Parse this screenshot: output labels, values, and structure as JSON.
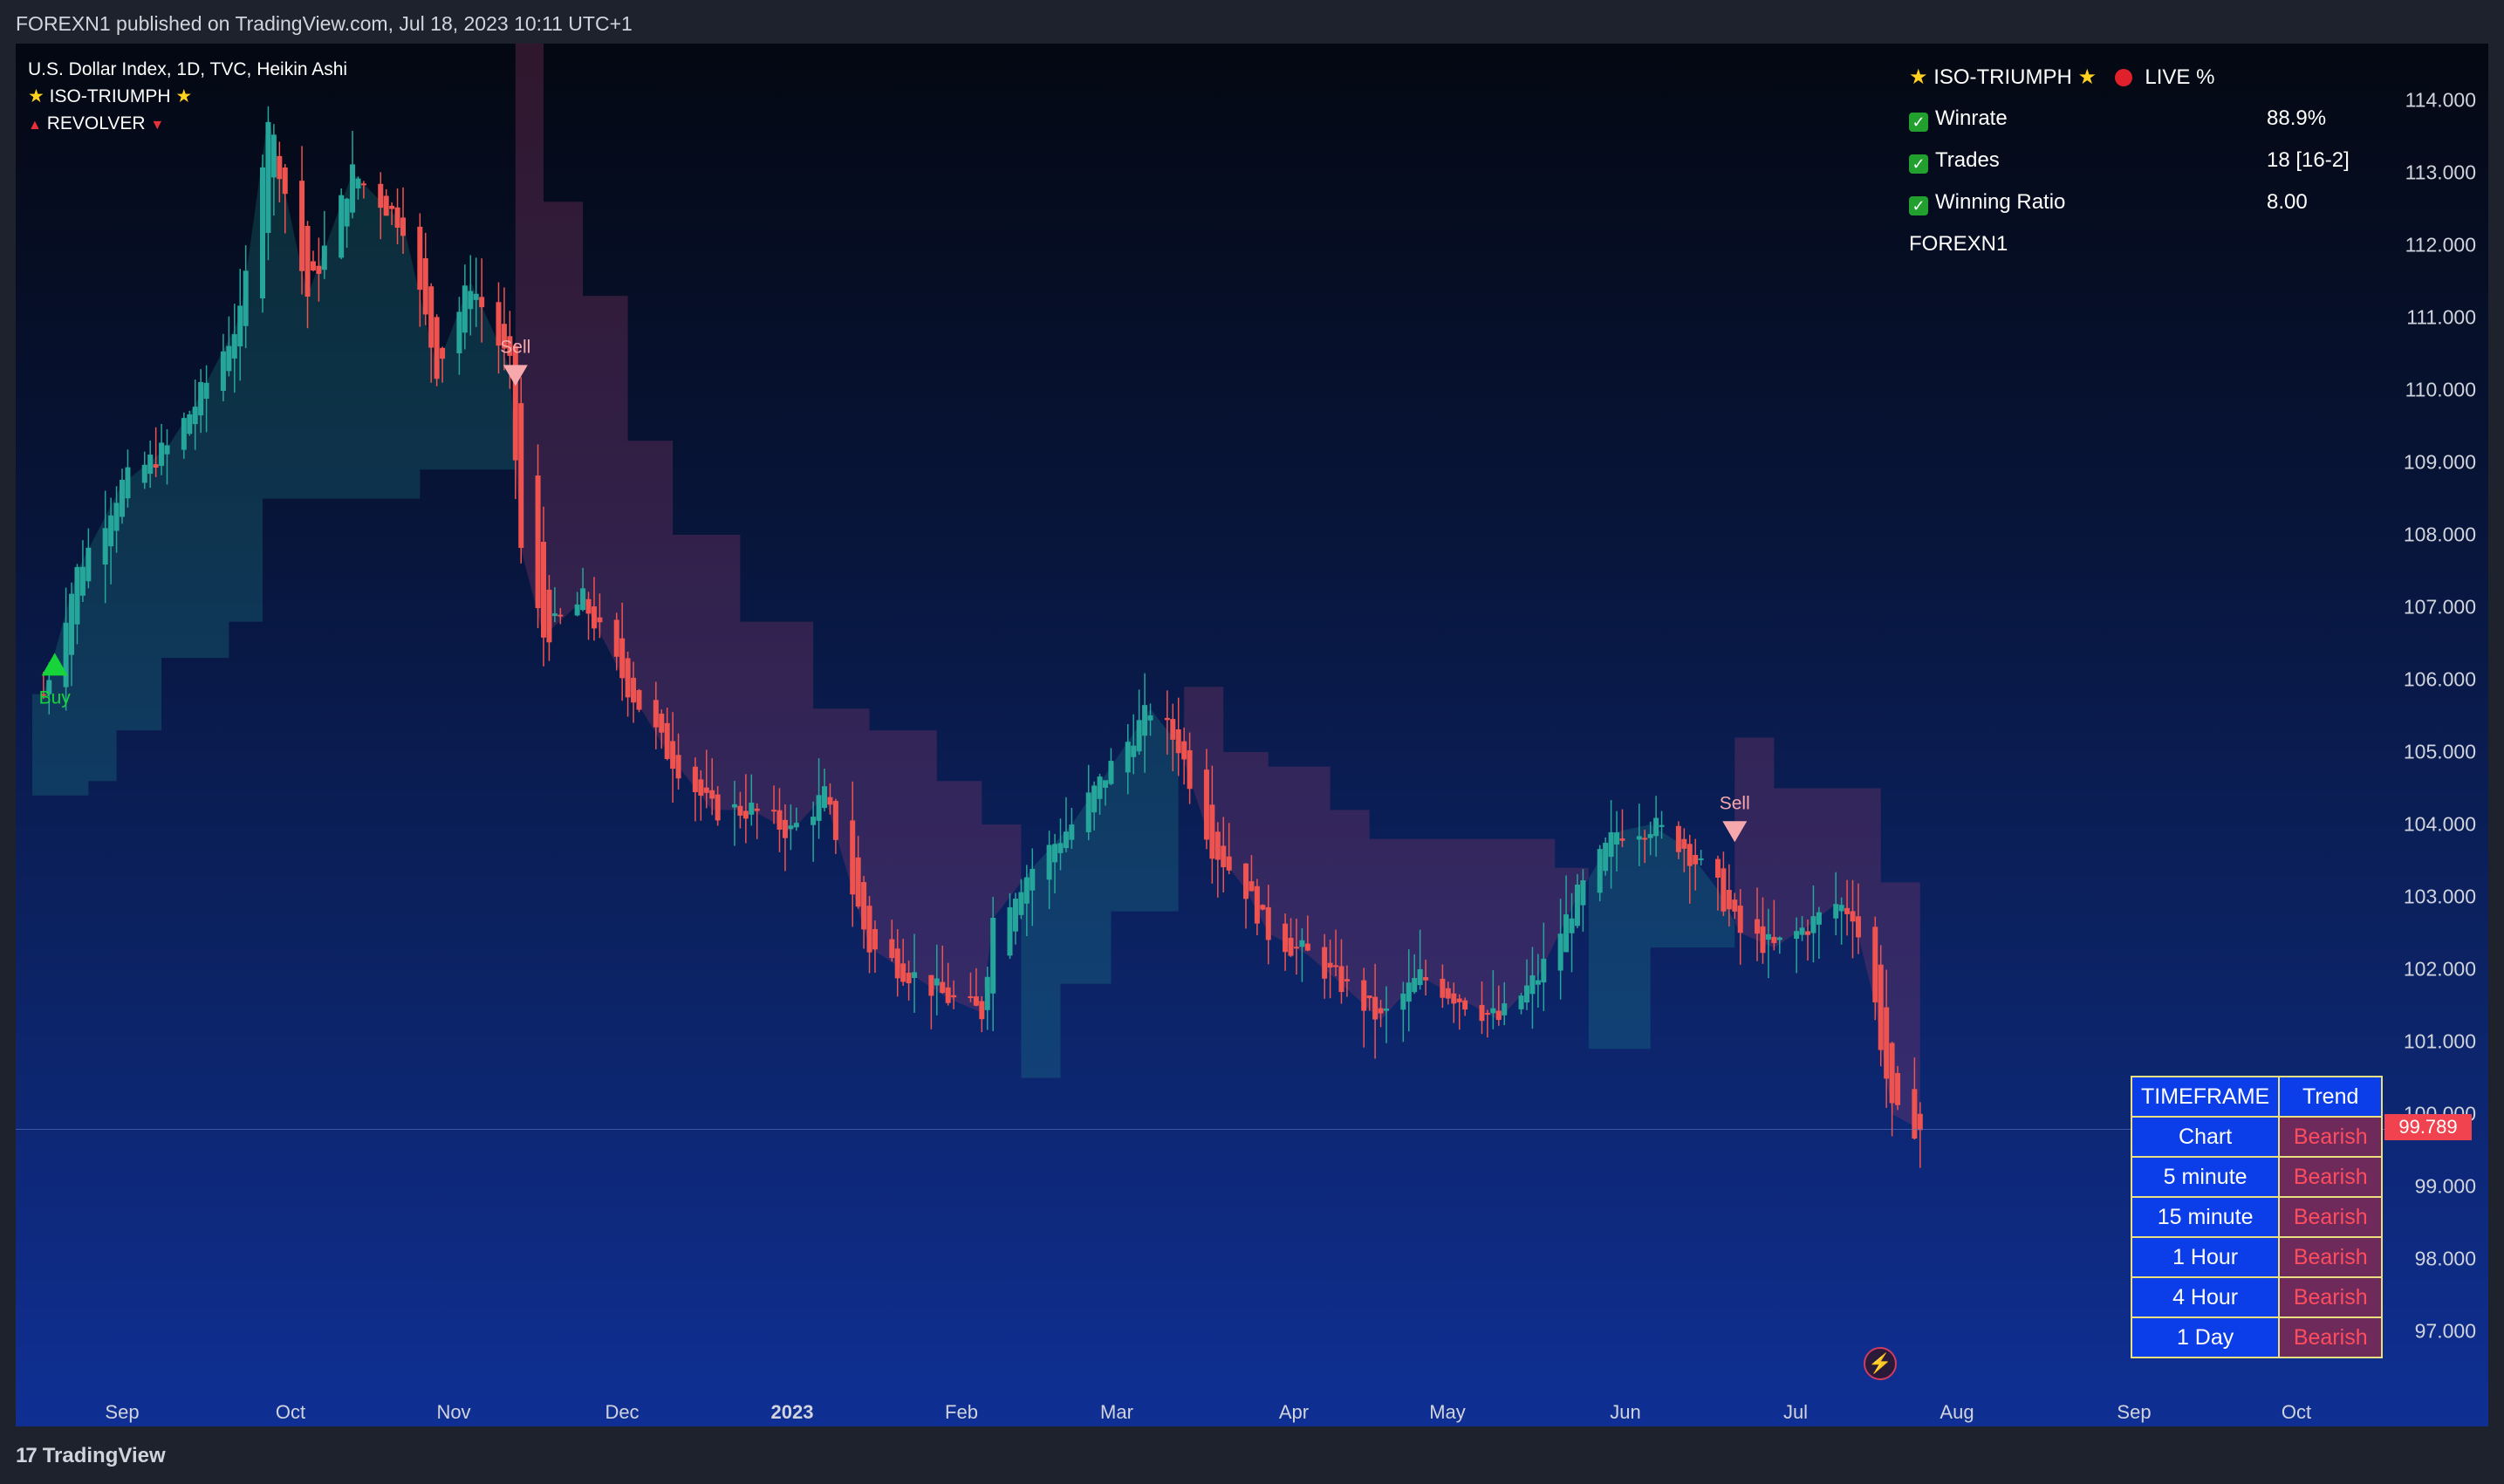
{
  "header": {
    "published": "FOREXN1 published on TradingView.com, Jul 18, 2023 10:11 UTC+1"
  },
  "legend": {
    "symbol": "U.S. Dollar Index, 1D, TVC, Heikin Ashi",
    "indicator1": "ISO-TRIUMPH",
    "indicator2": "REVOLVER"
  },
  "stats": {
    "title": "ISO-TRIUMPH",
    "live_label": "LIVE %",
    "rows": [
      {
        "label": "Winrate",
        "value": "88.9%"
      },
      {
        "label": "Trades",
        "value": "18 [16-2]"
      },
      {
        "label": "Winning Ratio",
        "value": "8.00"
      }
    ],
    "author": "FOREXN1"
  },
  "timeframe_table": {
    "header": [
      "TIMEFRAME",
      "Trend"
    ],
    "rows": [
      {
        "tf": "Chart",
        "trend": "Bearish"
      },
      {
        "tf": "5 minute",
        "trend": "Bearish"
      },
      {
        "tf": "15 minute",
        "trend": "Bearish"
      },
      {
        "tf": "1 Hour",
        "trend": "Bearish"
      },
      {
        "tf": "4 Hour",
        "trend": "Bearish"
      },
      {
        "tf": "1 Day",
        "trend": "Bearish"
      }
    ]
  },
  "signals": {
    "buy": "Buy",
    "sell": "Sell"
  },
  "last_price": "99.789",
  "footer": {
    "brand": "TradingView"
  },
  "colors": {
    "bull": "#26a69a",
    "bear": "#ef5350",
    "buy_signal": "#17d43a",
    "sell_signal": "#f7a8ad",
    "accent_blue": "#0b3de8"
  },
  "chart_data": {
    "type": "candlestick",
    "symbol": "U.S. Dollar Index, 1D, TVC, Heikin Ashi",
    "y_ticks": [
      "114.000",
      "113.000",
      "112.000",
      "111.000",
      "110.000",
      "109.000",
      "108.000",
      "107.000",
      "106.000",
      "105.000",
      "104.000",
      "103.000",
      "102.000",
      "101.000",
      "100.000",
      "99.000",
      "98.000",
      "97.000"
    ],
    "x_ticks": [
      "Sep",
      "Oct",
      "Nov",
      "Dec",
      "2023",
      "Feb",
      "Mar",
      "Apr",
      "May",
      "Jun",
      "Jul",
      "Aug",
      "Sep",
      "Oct"
    ],
    "ylim": [
      96,
      115.1
    ],
    "price_path": [
      [
        "2022-08-18",
        105.8
      ],
      [
        "2022-08-24",
        107.5
      ],
      [
        "2022-09-01",
        108.7
      ],
      [
        "2022-09-09",
        109.2
      ],
      [
        "2022-09-14",
        109.8
      ],
      [
        "2022-09-22",
        111.0
      ],
      [
        "2022-09-27",
        113.8
      ],
      [
        "2022-10-04",
        111.3
      ],
      [
        "2022-10-12",
        113.0
      ],
      [
        "2022-10-21",
        112.3
      ],
      [
        "2022-10-27",
        110.3
      ],
      [
        "2022-11-02",
        111.5
      ],
      [
        "2022-11-09",
        110.3
      ],
      [
        "2022-11-11",
        107.8
      ],
      [
        "2022-11-15",
        106.6
      ],
      [
        "2022-11-22",
        107.1
      ],
      [
        "2022-11-30",
        105.9
      ],
      [
        "2022-12-07",
        105.0
      ],
      [
        "2022-12-15",
        104.2
      ],
      [
        "2022-12-22",
        104.2
      ],
      [
        "2022-12-29",
        103.9
      ],
      [
        "2023-01-04",
        104.4
      ],
      [
        "2023-01-12",
        102.3
      ],
      [
        "2023-01-20",
        101.9
      ],
      [
        "2023-01-26",
        101.6
      ],
      [
        "2023-02-01",
        101.4
      ],
      [
        "2023-02-03",
        102.7
      ],
      [
        "2023-02-10",
        103.4
      ],
      [
        "2023-02-17",
        104.0
      ],
      [
        "2023-02-24",
        104.8
      ],
      [
        "2023-03-03",
        105.6
      ],
      [
        "2023-03-08",
        105.1
      ],
      [
        "2023-03-14",
        103.7
      ],
      [
        "2023-03-20",
        103.1
      ],
      [
        "2023-03-24",
        102.5
      ],
      [
        "2023-03-31",
        102.2
      ],
      [
        "2023-04-06",
        101.8
      ],
      [
        "2023-04-13",
        101.3
      ],
      [
        "2023-04-20",
        101.9
      ],
      [
        "2023-04-27",
        101.6
      ],
      [
        "2023-05-04",
        101.3
      ],
      [
        "2023-05-11",
        101.9
      ],
      [
        "2023-05-18",
        103.0
      ],
      [
        "2023-05-25",
        103.9
      ],
      [
        "2023-05-31",
        104.0
      ],
      [
        "2023-06-06",
        103.7
      ],
      [
        "2023-06-12",
        103.1
      ],
      [
        "2023-06-16",
        102.5
      ],
      [
        "2023-06-22",
        102.3
      ],
      [
        "2023-06-28",
        102.6
      ],
      [
        "2023-07-03",
        102.9
      ],
      [
        "2023-07-06",
        102.8
      ],
      [
        "2023-07-10",
        101.5
      ],
      [
        "2023-07-13",
        100.0
      ],
      [
        "2023-07-18",
        99.79
      ]
    ],
    "trail_segments": [
      {
        "trend": "bull",
        "points": [
          [
            "2022-08-16",
            104.4
          ],
          [
            "2022-08-26",
            104.6
          ],
          [
            "2022-08-31",
            105.3
          ],
          [
            "2022-09-08",
            106.3
          ],
          [
            "2022-09-20",
            106.8
          ],
          [
            "2022-09-26",
            108.5
          ],
          [
            "2022-10-14",
            108.5
          ],
          [
            "2022-10-24",
            108.9
          ],
          [
            "2022-11-10",
            108.9
          ]
        ]
      },
      {
        "trend": "bear",
        "points": [
          [
            "2022-11-10",
            115.0
          ],
          [
            "2022-11-15",
            112.6
          ],
          [
            "2022-11-22",
            111.3
          ],
          [
            "2022-11-30",
            109.3
          ],
          [
            "2022-12-08",
            108.0
          ],
          [
            "2022-12-20",
            106.8
          ],
          [
            "2023-01-02",
            105.6
          ],
          [
            "2023-01-12",
            105.3
          ],
          [
            "2023-01-24",
            104.6
          ],
          [
            "2023-02-01",
            104.0
          ],
          [
            "2023-02-08",
            104.0
          ]
        ]
      },
      {
        "trend": "bull",
        "points": [
          [
            "2023-02-08",
            100.5
          ],
          [
            "2023-02-15",
            101.8
          ],
          [
            "2023-02-24",
            102.8
          ],
          [
            "2023-03-08",
            102.8
          ]
        ]
      },
      {
        "trend": "bear",
        "points": [
          [
            "2023-03-09",
            105.9
          ],
          [
            "2023-03-16",
            105.0
          ],
          [
            "2023-03-24",
            104.8
          ],
          [
            "2023-04-04",
            104.2
          ],
          [
            "2023-04-11",
            103.8
          ],
          [
            "2023-05-02",
            103.8
          ],
          [
            "2023-05-14",
            103.4
          ],
          [
            "2023-05-20",
            103.4
          ]
        ]
      },
      {
        "trend": "bull",
        "points": [
          [
            "2023-05-20",
            100.9
          ],
          [
            "2023-05-31",
            102.3
          ],
          [
            "2023-06-15",
            102.3
          ]
        ]
      },
      {
        "trend": "bear",
        "points": [
          [
            "2023-06-15",
            105.2
          ],
          [
            "2023-06-22",
            104.5
          ],
          [
            "2023-07-05",
            104.5
          ],
          [
            "2023-07-11",
            103.2
          ],
          [
            "2023-07-18",
            103.2
          ]
        ]
      }
    ],
    "signals": [
      {
        "label": "Buy",
        "date": "2022-08-20",
        "price": 106.2
      },
      {
        "label": "Sell",
        "date": "2022-11-10",
        "price": 110.2
      },
      {
        "label": "Sell",
        "date": "2023-06-15",
        "price": 103.9
      }
    ],
    "last_price": 99.789
  }
}
